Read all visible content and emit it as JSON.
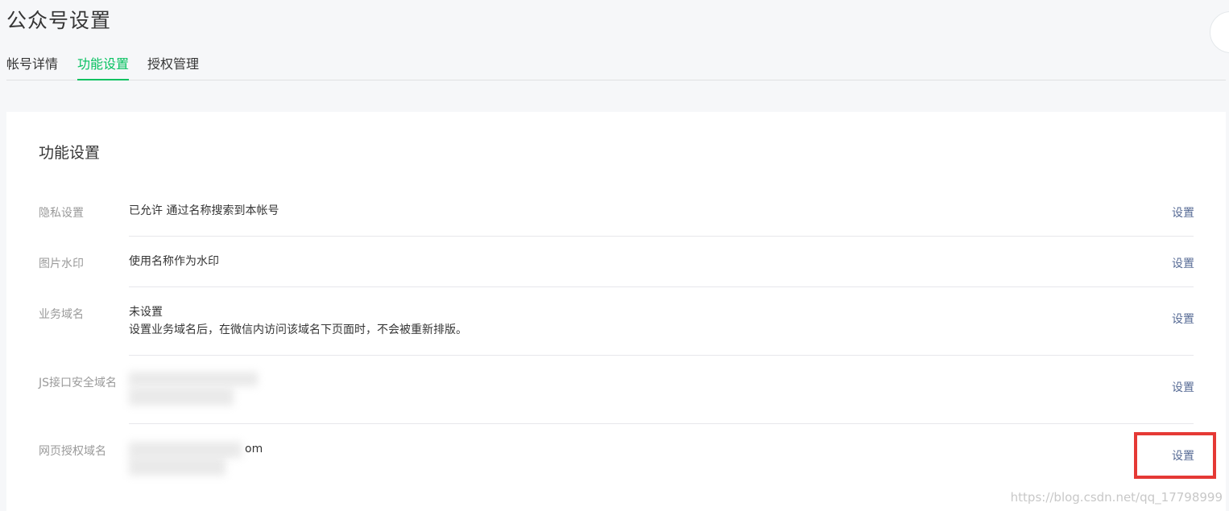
{
  "page": {
    "title": "公众号设置"
  },
  "tabs": [
    {
      "label": "帐号详情",
      "active": false
    },
    {
      "label": "功能设置",
      "active": true
    },
    {
      "label": "授权管理",
      "active": false
    }
  ],
  "card": {
    "title": "功能设置",
    "rows": [
      {
        "label": "隐私设置",
        "value_line1": "已允许 通过名称搜索到本帐号",
        "action": "设置"
      },
      {
        "label": "图片水印",
        "value_line1": "使用名称作为水印",
        "action": "设置"
      },
      {
        "label": "业务域名",
        "value_line1": "未设置",
        "value_line2": "设置业务域名后，在微信内访问该域名下页面时，不会被重新排版。",
        "action": "设置"
      },
      {
        "label": "JS接口安全域名",
        "value_line1": "",
        "action": "设置"
      },
      {
        "label": "网页授权域名",
        "value_line1": "om",
        "action": "设置"
      }
    ]
  },
  "watermark": "https://blog.csdn.net/qq_17798999",
  "colors": {
    "accent": "#07c160",
    "link": "#576b95",
    "highlight": "#e53935"
  }
}
